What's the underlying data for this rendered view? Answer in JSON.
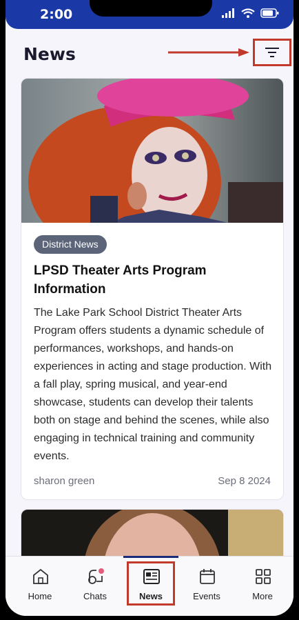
{
  "status_bar": {
    "time": "2:00"
  },
  "header": {
    "title": "News"
  },
  "articles": [
    {
      "category": "District News",
      "title": "LPSD Theater Arts Program Information",
      "body": "The Lake Park School District Theater Arts Program offers students a dynamic schedule of performances, workshops, and hands-on experiences in acting and stage production. With a fall play, spring musical, and year-end showcase, students can develop their talents both on stage and behind the scenes, while also engaging in technical training and community events.",
      "author": "sharon green",
      "date": "Sep 8 2024"
    }
  ],
  "tabs": [
    {
      "label": "Home",
      "icon": "home-icon"
    },
    {
      "label": "Chats",
      "icon": "chats-icon"
    },
    {
      "label": "News",
      "icon": "news-icon",
      "active": true
    },
    {
      "label": "Events",
      "icon": "calendar-icon"
    },
    {
      "label": "More",
      "icon": "grid-icon"
    }
  ],
  "colors": {
    "status_bar": "#1b39a6",
    "badge": "#5b6479",
    "annotation": "#c0392b"
  }
}
